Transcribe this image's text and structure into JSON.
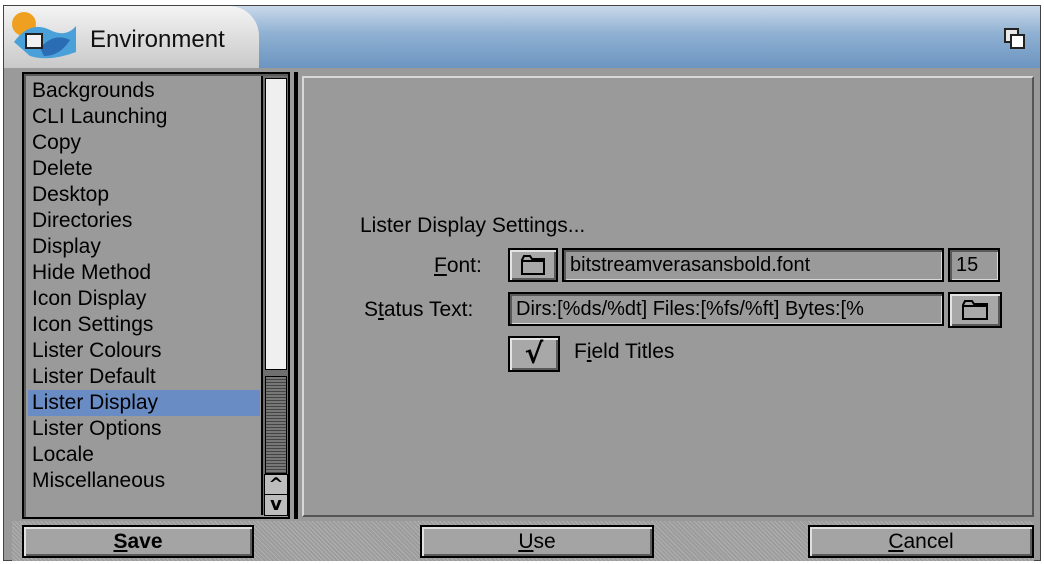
{
  "window": {
    "title": "Environment",
    "app_icon": "environment-app-icon",
    "depth_icon": "window-depth-icon"
  },
  "sidebar": {
    "items": [
      {
        "label": "Backgrounds"
      },
      {
        "label": "CLI Launching"
      },
      {
        "label": "Copy"
      },
      {
        "label": "Delete"
      },
      {
        "label": "Desktop"
      },
      {
        "label": "Directories"
      },
      {
        "label": "Display"
      },
      {
        "label": "Hide Method"
      },
      {
        "label": "Icon Display"
      },
      {
        "label": "Icon Settings"
      },
      {
        "label": "Lister Colours"
      },
      {
        "label": "Lister Default"
      },
      {
        "label": "Lister Display"
      },
      {
        "label": "Lister Options"
      },
      {
        "label": "Locale"
      },
      {
        "label": "Miscellaneous"
      }
    ],
    "selected_index": 12,
    "selected_color": "#6a8cc4",
    "scroll_up": "^",
    "scroll_down": "v"
  },
  "settings": {
    "heading": "Lister Display Settings...",
    "font": {
      "label_underlined": "F",
      "label_rest": "ont:",
      "value": "bitstreamverasansbold.font",
      "size": "15"
    },
    "status_text": {
      "label_before": "S",
      "label_underlined": "t",
      "label_rest": "atus Text:",
      "value": "Dirs:[%ds/%dt] Files:[%fs/%ft] Bytes:[%"
    },
    "field_titles": {
      "checked": true,
      "check_mark": "√",
      "label_before": "F",
      "label_underlined": "i",
      "label_rest": "eld Titles"
    }
  },
  "buttons": {
    "save": {
      "underlined": "S",
      "rest": "ave"
    },
    "use": {
      "underlined": "U",
      "rest": "se"
    },
    "cancel": {
      "underlined": "C",
      "rest": "ancel"
    }
  }
}
